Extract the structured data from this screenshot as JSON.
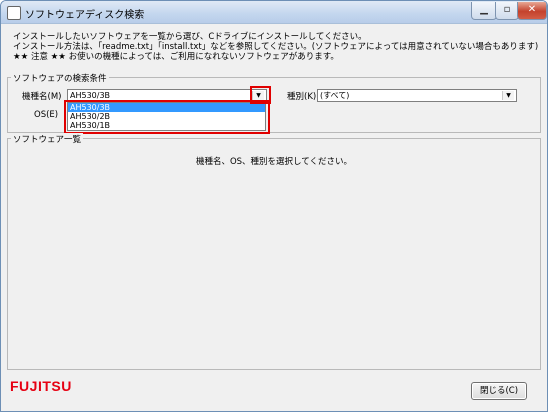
{
  "window": {
    "title": "ソフトウェアディスク検索",
    "min_glyph": "▁",
    "max_glyph": "▫",
    "close_glyph": "✕"
  },
  "instructions": [
    "インストールしたいソフトウェアを一覧から選び、Cドライブにインストールしてください。",
    "インストール方法は、「readme.txt」「install.txt」などを参照してください。(ソフトウェアによっては用意されていない場合もあります)",
    "★★ 注意 ★★ お使いの機種によっては、ご利用になれないソフトウェアがあります。"
  ],
  "search": {
    "group_label": "ソフトウェアの検索条件",
    "model_label": "機種名(M)",
    "model_value": "AH530/3B",
    "model_options": [
      "AH530/3B",
      "AH530/2B",
      "AH530/1B"
    ],
    "os_label": "OS(E)",
    "type_label": "種別(K)",
    "type_value": "(すべて)"
  },
  "list": {
    "group_label": "ソフトウェア一覧",
    "message": "機種名、OS、種別を選択してください。"
  },
  "footer": {
    "logo": "FUJITSU",
    "close_label": "閉じる(C)"
  },
  "colors": {
    "highlight": "#3399ff",
    "annotation": "#e00000",
    "logo": "#e60012"
  }
}
